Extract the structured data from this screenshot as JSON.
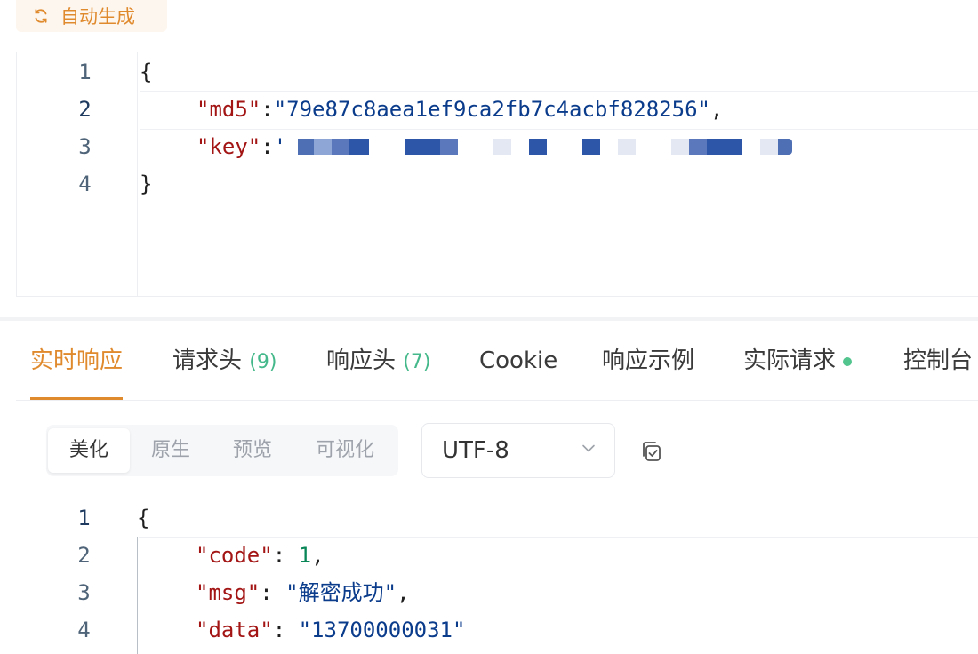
{
  "autogen": {
    "label": "自动生成",
    "icon": "refresh-icon",
    "color": "#e08a2e"
  },
  "request_body": {
    "lines": [
      {
        "num": "1",
        "text": "{"
      },
      {
        "num": "2",
        "key": "\"md5\"",
        "sep": ":",
        "value": "\"79e87c8aea1ef9ca2fb7c4acbf828256\"",
        "tail": ","
      },
      {
        "num": "3",
        "key": "\"key\"",
        "sep": ":",
        "value_prefix": "'"
      },
      {
        "num": "4",
        "text": "}"
      }
    ]
  },
  "tabs": [
    {
      "label": "实时响应",
      "active": true
    },
    {
      "label": "请求头",
      "count": "(9)"
    },
    {
      "label": "响应头",
      "count": "(7)"
    },
    {
      "label": "Cookie"
    },
    {
      "label": "响应示例"
    },
    {
      "label": "实际请求",
      "dot": true
    },
    {
      "label": "控制台"
    }
  ],
  "view_modes": [
    {
      "label": "美化",
      "active": true
    },
    {
      "label": "原生"
    },
    {
      "label": "预览"
    },
    {
      "label": "可视化"
    }
  ],
  "encoding": {
    "selected": "UTF-8",
    "icon": "chevron-down-icon"
  },
  "copy_icon": "copy-check-icon",
  "response_body": {
    "lines": [
      {
        "num": "1",
        "text": "{"
      },
      {
        "num": "2",
        "key": "\"code\"",
        "sep": ": ",
        "value": "1",
        "tail": ","
      },
      {
        "num": "3",
        "key": "\"msg\"",
        "sep": ": ",
        "value": "\"解密成功\"",
        "tail": ","
      },
      {
        "num": "4",
        "key": "\"data\"",
        "sep": ": ",
        "value": "\"13700000031\""
      }
    ]
  },
  "colors": {
    "accent": "#e08a2e",
    "json_key": "#a31515",
    "json_string": "#0b3c8c",
    "json_number": "#098658",
    "badge_green": "#44b88a"
  }
}
